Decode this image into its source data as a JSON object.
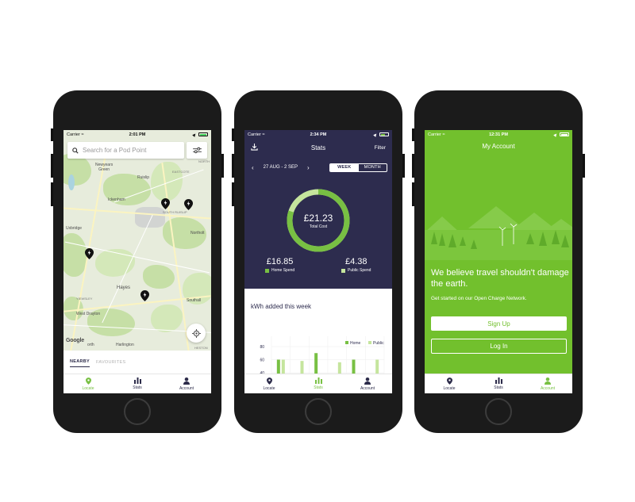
{
  "screens": {
    "locate": {
      "status": {
        "carrier": "Carrier",
        "time": "2:01 PM"
      },
      "search": {
        "placeholder": "Search for a Pod Point"
      },
      "map_labels": {
        "newyears_green": "Newyears\nGreen",
        "eastcote": "EASTCOTE",
        "north": "NORTH",
        "ruislip": "Ruislip",
        "ickenham": "Ickenham",
        "south_ruislip": "SOUTH RUISLIP",
        "northolt": "Northolt",
        "uxbridge": "Uxbridge",
        "hayes": "Hayes",
        "yiewsley": "YIEWSLEY",
        "southall": "Southall",
        "west_drayton": "West Drayton",
        "north_short": "orth",
        "harlington": "Harlington",
        "heston": "HESTON"
      },
      "google_logo": "Google",
      "tabs": {
        "nearby": "NEARBY",
        "favourites": "FAVOURITES"
      }
    },
    "stats": {
      "status": {
        "carrier": "Carrier",
        "time": "2:34 PM"
      },
      "title": "Stats",
      "filter": "Filter",
      "date_range": "27 AUG - 2 SEP",
      "toggle": {
        "week": "WEEK",
        "month": "MONTH"
      },
      "total": {
        "amount": "£21.23",
        "label": "Total Cost",
        "home_fraction": 0.8
      },
      "home_spend": {
        "amount": "£16.85",
        "label": "Home Spend"
      },
      "public_spend": {
        "amount": "£4.38",
        "label": "Public Spend"
      },
      "kwh_title": "kWh added this week",
      "chart_data": {
        "type": "bar",
        "legend": [
          "Home",
          "Public"
        ],
        "yticks": [
          80,
          60,
          40
        ],
        "visible_ylim": [
          40,
          90
        ],
        "series": [
          {
            "name": "Home",
            "values": [
              60,
              0,
              70,
              0,
              60,
              0
            ]
          },
          {
            "name": "Public",
            "values": [
              60,
              58,
              0,
              56,
              0,
              60
            ]
          }
        ]
      }
    },
    "account": {
      "status": {
        "carrier": "Carrier",
        "time": "12:31 PM"
      },
      "title": "My Account",
      "headline": "We believe travel shouldn't damage the earth.",
      "subtext": "Get started on our Open Charge Network.",
      "signup": "Sign Up",
      "login": "Log In"
    }
  },
  "tabbar": {
    "locate": "Locate",
    "stats": "Stats",
    "account": "Account"
  },
  "colors": {
    "brand_green": "#78c043",
    "navy": "#2d2c4e",
    "account_green": "#72c02d",
    "light_green": "#c5e59d"
  },
  "icons": [
    "wifi-icon",
    "location-arrow-icon",
    "battery-icon",
    "search-icon",
    "sliders-icon",
    "charging-pin-icon",
    "crosshair-icon",
    "map-pin-icon",
    "bar-chart-icon",
    "user-icon",
    "download-icon",
    "chevron-left-icon",
    "chevron-right-icon"
  ]
}
